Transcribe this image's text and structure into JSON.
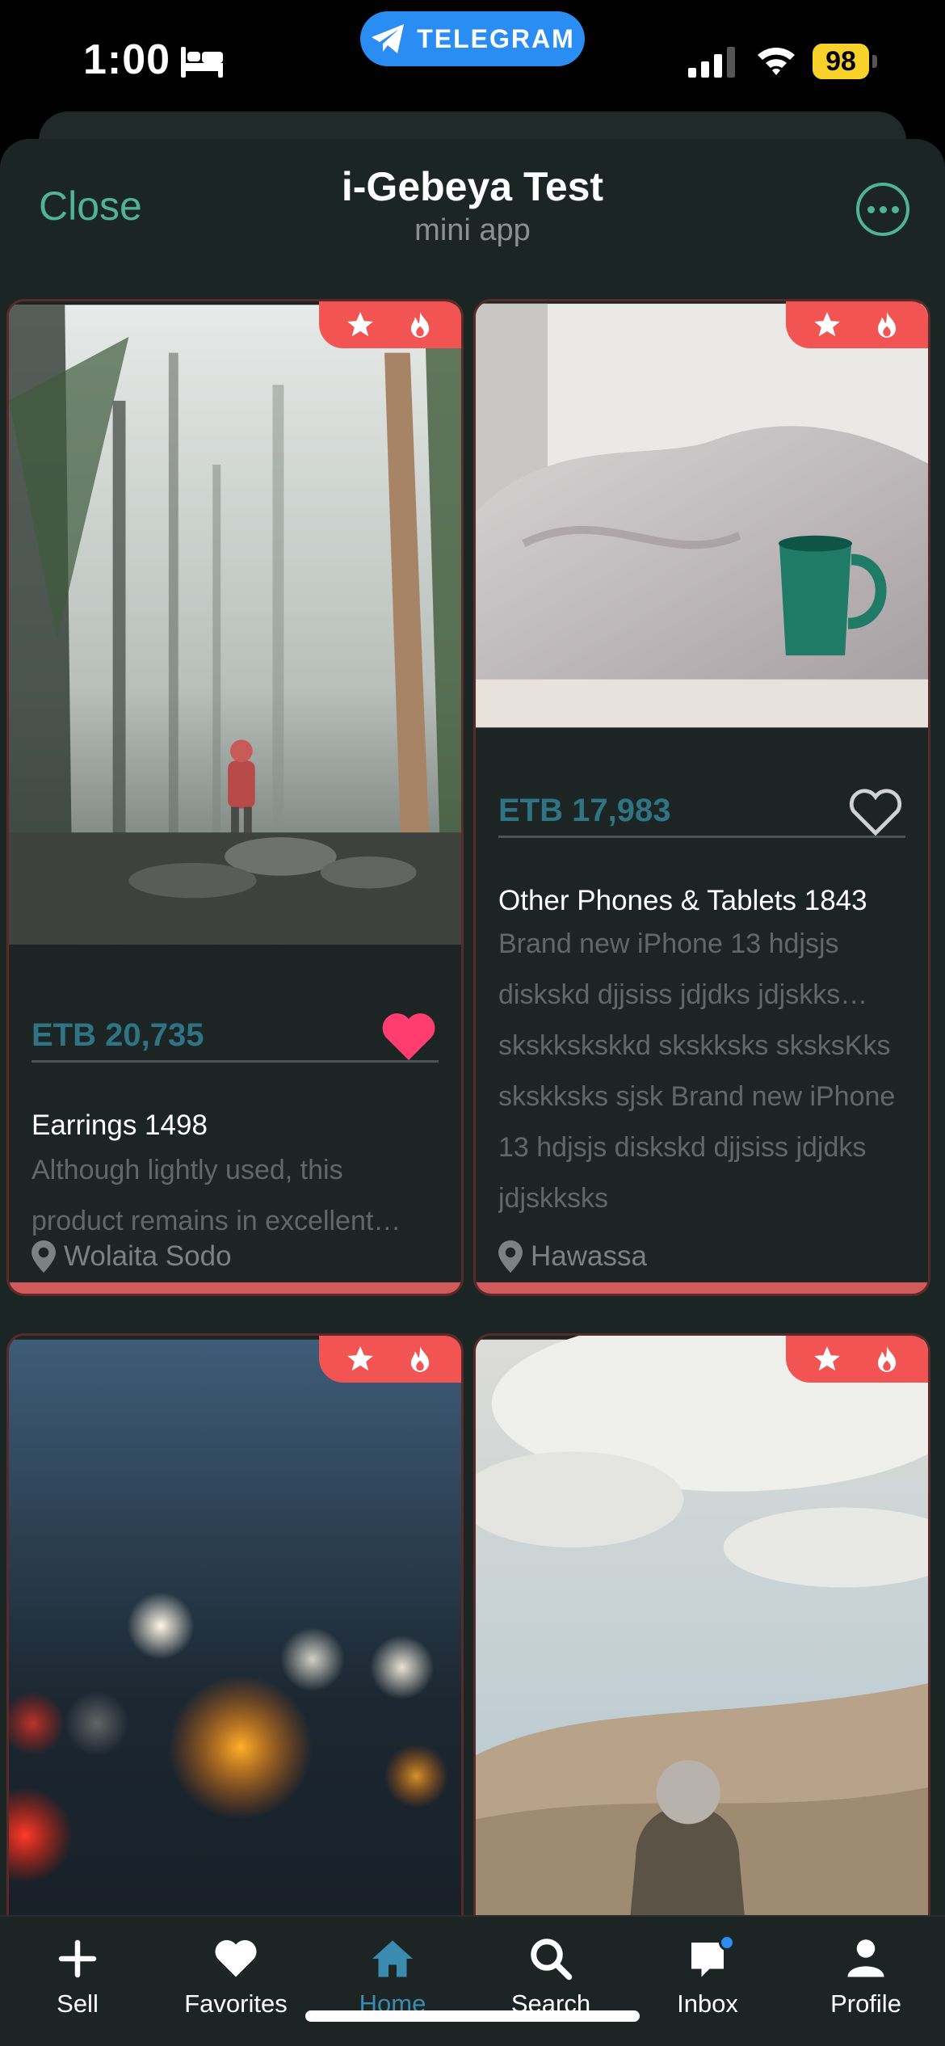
{
  "status_bar": {
    "time": "1:00",
    "telegram_label": "TELEGRAM",
    "battery": "98"
  },
  "header": {
    "close": "Close",
    "title": "i-Gebeya Test",
    "subtitle": "mini app"
  },
  "listings": [
    {
      "price": "ETB 20,735",
      "favorited": true,
      "title": "Earrings 1498",
      "description": "Although lightly used, this product remains in excellent…",
      "location": "Wolaita Sodo",
      "image": "misty-forest-hiker"
    },
    {
      "price": "ETB 17,983",
      "favorited": false,
      "title": "Other Phones & Tablets 1843",
      "description": "Brand new iPhone 13 hdjsjs diskskd djjsiss jdjdks jdjskks… skskkskskkd skskksks sksksKks skskksks sjsk Brand new iPhone 13 hdjsjs diskskd djjsiss jdjdks jdjskksks",
      "location": "Hawassa",
      "image": "green-mug-bedsheets"
    },
    {
      "price": "",
      "image": "bokeh-city-lights"
    },
    {
      "price": "",
      "image": "person-on-bench-dunes"
    }
  ],
  "tabs": [
    {
      "label": "Sell",
      "icon": "plus-icon",
      "active": false
    },
    {
      "label": "Favorites",
      "icon": "heart-icon",
      "active": false
    },
    {
      "label": "Home",
      "icon": "home-icon",
      "active": true
    },
    {
      "label": "Search",
      "icon": "search-icon",
      "active": false
    },
    {
      "label": "Inbox",
      "icon": "chat-icon",
      "active": false
    },
    {
      "label": "Profile",
      "icon": "person-icon",
      "active": false
    }
  ],
  "colors": {
    "accent": "#4fb394",
    "badge": "#f25454",
    "price": "#2f7385",
    "heart_active": "#ff3d6e",
    "tab_active": "#3b8bb0"
  }
}
